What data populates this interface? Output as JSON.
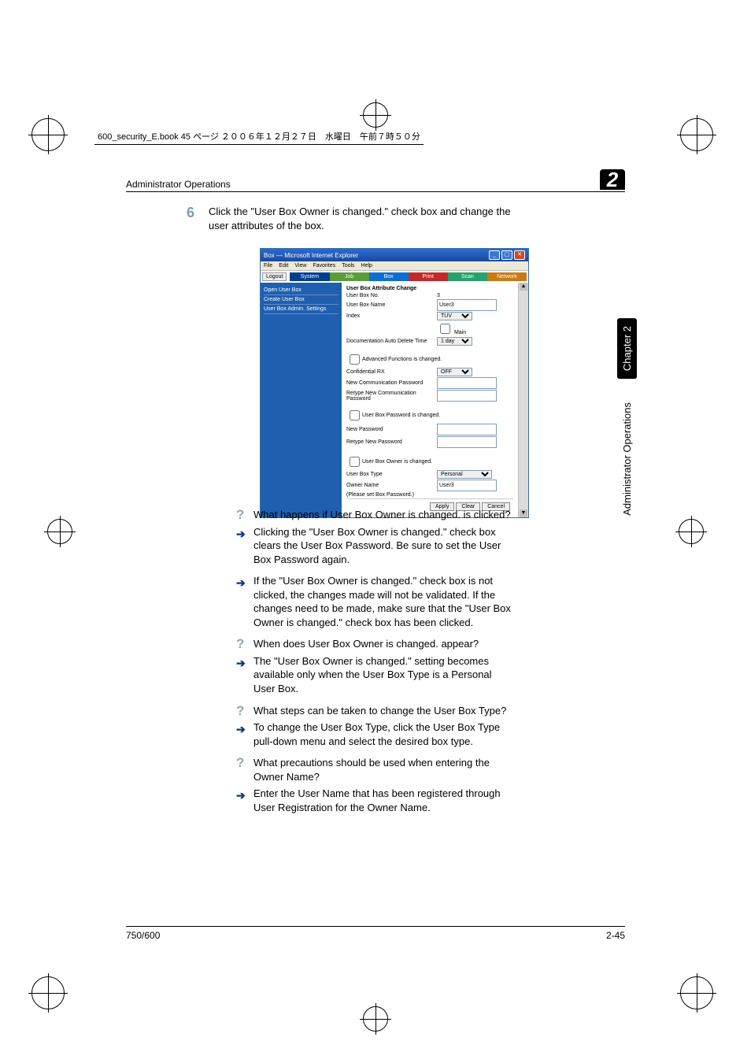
{
  "book_header": "600_security_E.book  45 ページ  ２００６年１２月２７日　水曜日　午前７時５０分",
  "section_title": "Administrator Operations",
  "section_number": "2",
  "side_tab": "Chapter 2",
  "side_text": "Administrator Operations",
  "step": {
    "number": "6",
    "text": "Click the \"User Box Owner is changed.\" check box and change the user attributes of the box."
  },
  "screenshot": {
    "title": "Box — Microsoft Internet Explorer",
    "menus": [
      "File",
      "Edit",
      "View",
      "Favorites",
      "Tools",
      "Help"
    ],
    "logout": "Logout",
    "tabs": {
      "system": "System",
      "job": "Job",
      "box": "Box",
      "print": "Print",
      "scan": "Scan",
      "network": "Network"
    },
    "nav": [
      "Open User Box",
      "Create User Box",
      "User Box Admin. Settings"
    ],
    "main": {
      "heading": "User Box Attribute Change",
      "rows": {
        "userboxno_label": "User Box No.",
        "userboxno_value": "3",
        "userboxname_label": "User Box Name",
        "userboxname_value": "User3",
        "index_label": "Index",
        "index_value": "TUV",
        "main_check": "Main",
        "autodel_label": "Documentation Auto Delete Time",
        "autodel_value": "1 day"
      },
      "group1": {
        "chk": "Advanced Functions is changed.",
        "conf_label": "Confidential RX",
        "conf_value": "OFF",
        "newcomm": "New Communication Password",
        "retype_comm": "Retype New Communication Password"
      },
      "group2": {
        "chk": "User Box Password is changed.",
        "newpw": "New Password",
        "retype_pw": "Retype New Password"
      },
      "group3": {
        "chk": "User Box Owner is changed.",
        "type_label": "User Box Type",
        "type_value": "Personal",
        "owner_label": "Owner Name",
        "owner_value": "User3",
        "note": "(Please set Box Password.)"
      },
      "buttons": {
        "apply": "Apply",
        "clear": "Clear",
        "cancel": "Cancel"
      }
    }
  },
  "qa": [
    {
      "q": "What happens if User Box Owner is changed. is clicked?",
      "a": "Clicking the \"User Box Owner is changed.\" check box clears the User Box Password. Be sure to set the User Box Password again."
    },
    {
      "a": "If the \"User Box Owner is changed.\" check box is not clicked, the changes made will not be validated. If the changes need to be made, make sure that the \"User Box Owner is changed.\" check box has been clicked."
    },
    {
      "q": "When does User Box Owner is changed. appear?",
      "a": "The \"User Box Owner is changed.\" setting becomes available only when the User Box Type is a Personal User Box."
    },
    {
      "q": "What steps can be taken to change the User Box Type?",
      "a": "To change the User Box Type, click the User Box Type pull-down menu and select the desired box type."
    },
    {
      "q": "What precautions should be used when entering the Owner Name?",
      "a": "Enter the User Name that has been registered through User Registration for the Owner Name."
    }
  ],
  "footer": {
    "left": "750/600",
    "right": "2-45"
  }
}
